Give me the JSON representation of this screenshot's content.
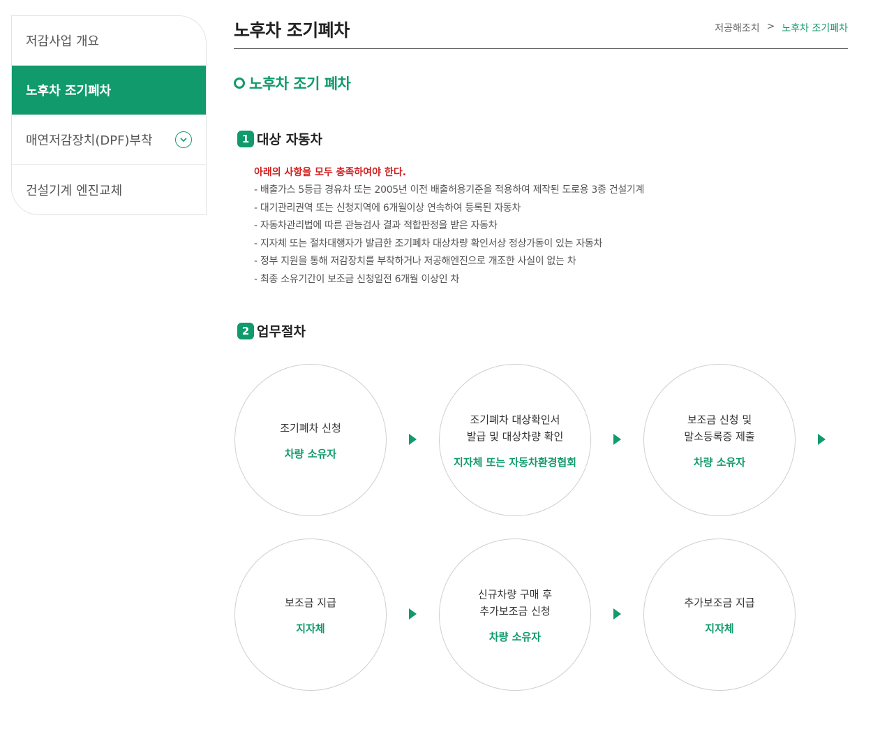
{
  "sidebar": {
    "items": [
      {
        "label": "저감사업 개요"
      },
      {
        "label": "노후차 조기폐차"
      },
      {
        "label": "매연저감장치(DPF)부착"
      },
      {
        "label": "건설기계 엔진교체"
      }
    ]
  },
  "header": {
    "title": "노후차 조기폐차",
    "breadcrumb": {
      "parent": "저공해조치",
      "separator": ">",
      "current": "노후차 조기폐차"
    }
  },
  "section": {
    "title": "노후차 조기 폐차"
  },
  "target": {
    "number": "1",
    "heading": "대상 자동차",
    "requirement": "아래의 사항을 모두 충족하여야 한다.",
    "items": [
      "- 배출가스 5등급 경유차 또는 2005년 이전 배출허용기준을 적용하여 제작된 도로용 3종 건설기계",
      "- 대기관리권역 또는 신청지역에 6개월이상 연속하여 등록된 자동차",
      "- 자동차관리법에 따른 관능검사 결과 적합판정을 받은 자동차",
      "- 지자체 또는 절차대행자가 발급한 조기폐차 대상차량 확인서상 정상가동이 있는 자동차",
      "- 정부 지원을 통해 저감장치를 부착하거나 저공해엔진으로 개조한 사실이 없는 차",
      "- 최종 소유기간이 보조금 신청일전 6개월 이상인 차"
    ]
  },
  "procedure": {
    "number": "2",
    "heading": "업무절차",
    "steps": [
      {
        "line1": "조기폐차 신청",
        "line2": "",
        "actor": "차량 소유자"
      },
      {
        "line1": "조기폐차 대상확인서",
        "line2": "발급 및 대상차량 확인",
        "actor": "지자체 또는 자동차환경협회"
      },
      {
        "line1": "보조금 신청 및",
        "line2": "말소등록증 제출",
        "actor": "차량 소유자"
      },
      {
        "line1": "보조금 지급",
        "line2": "",
        "actor": "지자체"
      },
      {
        "line1": "신규차량 구매 후",
        "line2": "추가보조금 신청",
        "actor": "차량 소유자"
      },
      {
        "line1": "추가보조금 지급",
        "line2": "",
        "actor": "지자체"
      }
    ]
  },
  "colors": {
    "accent": "#119a6c",
    "warning": "#d21f1f"
  },
  "icons": {
    "expand": "chevron-down-icon",
    "bullet": "ring-bullet-icon",
    "step": "arrow-right-icon"
  }
}
